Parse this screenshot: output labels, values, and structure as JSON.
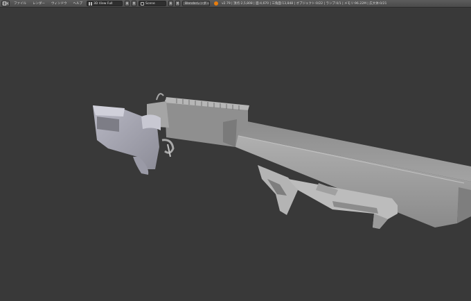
{
  "header": {
    "menus": [
      "ファイル",
      "レンダー",
      "ウィンドウ",
      "ヘルプ"
    ],
    "screen_layout": "3D View Full",
    "scene": "Scene",
    "render_engine": "Blenderレンダー",
    "stats": "v2.79 | 頂点:2,5,808 | 面:4,670 | 三角面:13,848 | オブジェクト:0/22 | ランプ:0/1 | メモリ:96.22M | 広大体:0/21"
  },
  "icons": {
    "editor_type": "3d-view-icon",
    "layout": "grid-icon",
    "scene": "scene-icon",
    "engine": "render-icon",
    "info": "blender-logo-icon"
  },
  "colors": {
    "viewport_bg": "#393939",
    "header_bg": "#4e4e4e",
    "model_gray": "#9a9a9a"
  }
}
